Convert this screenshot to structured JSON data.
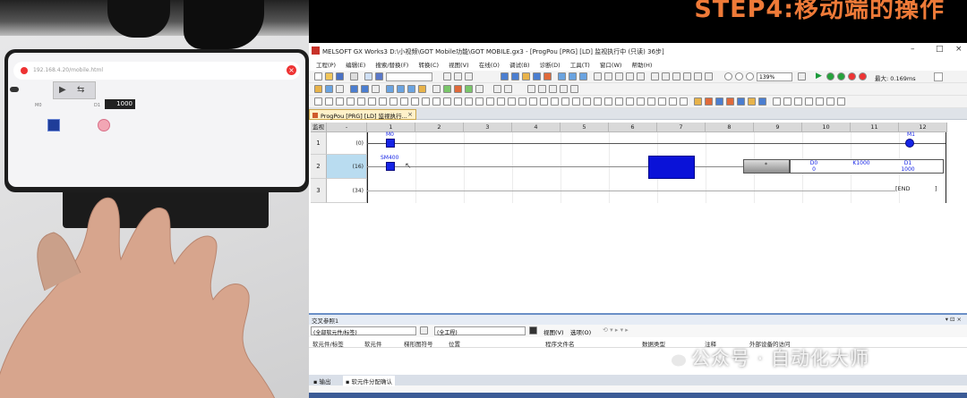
{
  "banner": {
    "text": "STEP4:移动端的操作"
  },
  "phone": {
    "url": "192.168.4.20/mobile.html",
    "label_left": "M0",
    "label_right": "D1",
    "value": "1000"
  },
  "window": {
    "title": "MELSOFT GX Works3 D:\\小视频\\GOT Mobile功能\\GOT MOBILE.gx3 - [ProgPou [PRG] [LD] 监视执行中 (只读) 36步]",
    "controls": {
      "minimize": "–",
      "maximize": "□",
      "close": "×"
    }
  },
  "menu": [
    "工程(P)",
    "编辑(E)",
    "搜索/替换(F)",
    "转换(C)",
    "视图(V)",
    "在线(O)",
    "调试(B)",
    "诊断(D)",
    "工具(T)",
    "窗口(W)",
    "帮助(H)"
  ],
  "toolbar": {
    "zoom": "139%",
    "scan_label": "最大: 0.169ms"
  },
  "tab": {
    "label": "ProgPou [PRG] [LD] 监视执行...",
    "close": "×"
  },
  "ladder": {
    "corner": "监视读取",
    "dash": "-",
    "columns": [
      "1",
      "2",
      "3",
      "4",
      "5",
      "6",
      "7",
      "8",
      "9",
      "10",
      "11",
      "12"
    ],
    "rows": [
      {
        "num": "1",
        "step": "(0)"
      },
      {
        "num": "2",
        "step": "(16)"
      },
      {
        "num": "3",
        "step": "(34)"
      }
    ],
    "r1": {
      "contact": "M0",
      "coil": "M1"
    },
    "r2": {
      "contact": "SM400",
      "instr": "*",
      "op1": "D0",
      "op1v": "0",
      "op2": "K1000",
      "op3": "D1",
      "op3v": "1000"
    },
    "r3": {
      "end": "END"
    }
  },
  "xref": {
    "title": "交叉参照1",
    "filter": "(全部软元件/标签)",
    "scope": "(全工程)",
    "view_btn": "视图(V)",
    "option_btn": "选项(O)",
    "cols": [
      "软元件/标签",
      "软元件",
      "梯形图符号",
      "位置",
      "程序文件名",
      "数据类型",
      "注释",
      "外部设备的访问"
    ],
    "bottom_tabs": [
      "输出",
      "软元件分配确认"
    ]
  },
  "watermark": "公众号 · 自动化大师",
  "colors": {
    "contact": "#1524e6",
    "banner": "#ee7a38",
    "tab": "#fff1c9",
    "highlight": "#0a12d8"
  }
}
